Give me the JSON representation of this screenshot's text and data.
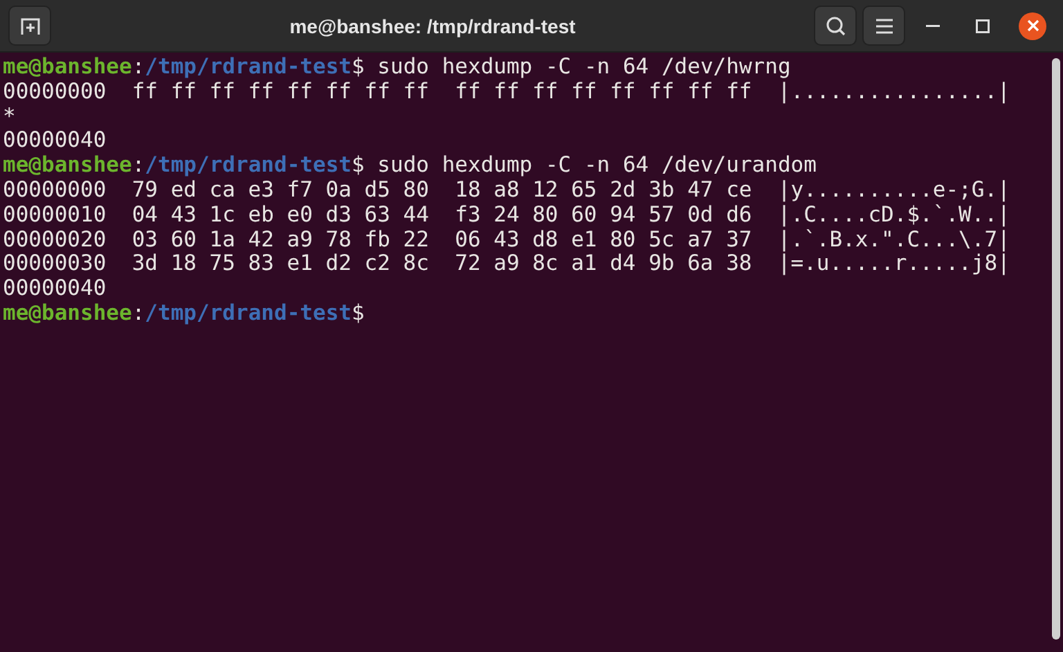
{
  "window": {
    "title": "me@banshee: /tmp/rdrand-test"
  },
  "lines": [
    {
      "kind": "prompt",
      "user_host": "me@banshee",
      "separator": ":",
      "path": "/tmp/rdrand-test",
      "symbol": "$",
      "command": " sudo hexdump -C -n 64 /dev/hwrng"
    },
    {
      "kind": "output",
      "text": "00000000  ff ff ff ff ff ff ff ff  ff ff ff ff ff ff ff ff  |................|"
    },
    {
      "kind": "output",
      "text": "*"
    },
    {
      "kind": "output",
      "text": "00000040"
    },
    {
      "kind": "prompt",
      "user_host": "me@banshee",
      "separator": ":",
      "path": "/tmp/rdrand-test",
      "symbol": "$",
      "command": " sudo hexdump -C -n 64 /dev/urandom"
    },
    {
      "kind": "output",
      "text": "00000000  79 ed ca e3 f7 0a d5 80  18 a8 12 65 2d 3b 47 ce  |y..........e-;G.|"
    },
    {
      "kind": "output",
      "text": "00000010  04 43 1c eb e0 d3 63 44  f3 24 80 60 94 57 0d d6  |.C....cD.$.`.W..|"
    },
    {
      "kind": "output",
      "text": "00000020  03 60 1a 42 a9 78 fb 22  06 43 d8 e1 80 5c a7 37  |.`.B.x.\".C...\\.7|"
    },
    {
      "kind": "output",
      "text": "00000030  3d 18 75 83 e1 d2 c2 8c  72 a9 8c a1 d4 9b 6a 38  |=.u.....r.....j8|"
    },
    {
      "kind": "output",
      "text": "00000040"
    },
    {
      "kind": "prompt",
      "user_host": "me@banshee",
      "separator": ":",
      "path": "/tmp/rdrand-test",
      "symbol": "$"
    }
  ]
}
